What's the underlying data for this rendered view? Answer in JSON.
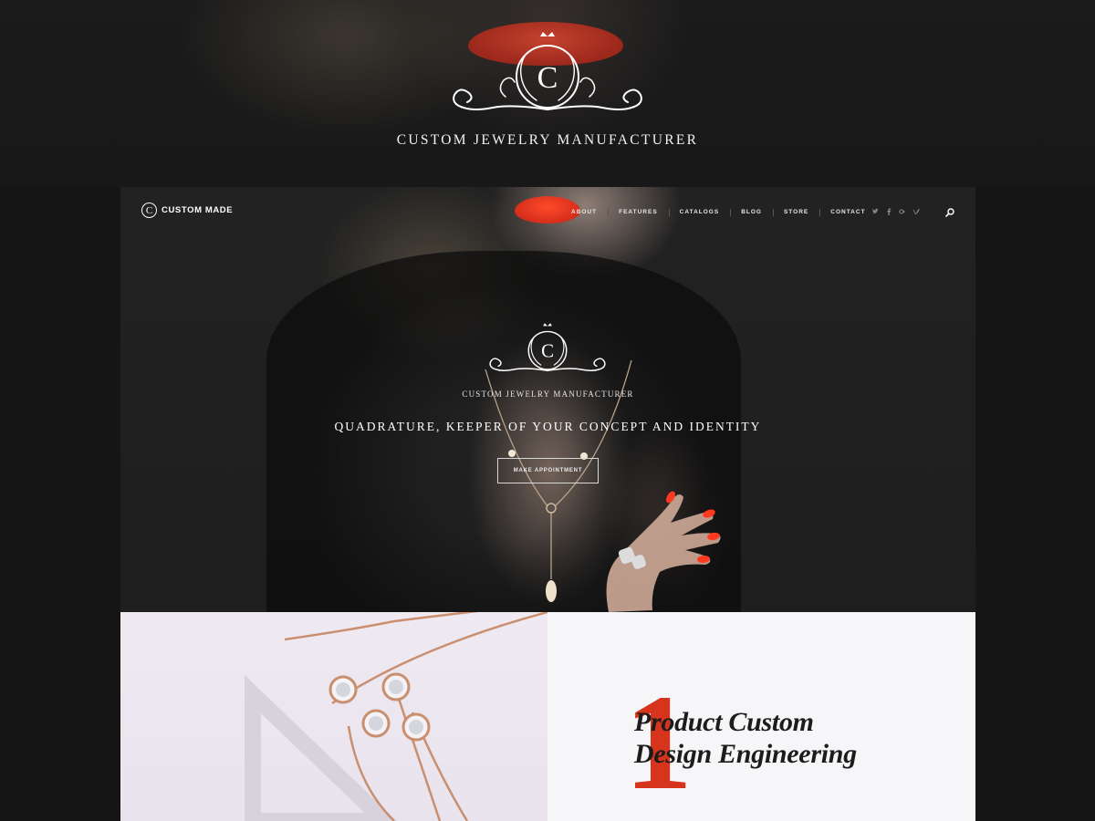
{
  "banner": {
    "emblem_letter": "C",
    "title": "CUSTOM JEWELRY MANUFACTURER"
  },
  "nav": {
    "logo_letter": "C",
    "logo_text": "CUSTOM MADE",
    "items": [
      "ABOUT",
      "FEATURES",
      "CATALOGS",
      "BLOG",
      "STORE",
      "CONTACT"
    ],
    "social_icons": [
      "twitter-icon",
      "facebook-icon",
      "google-plus-icon",
      "vimeo-icon"
    ],
    "social_glyphs": [
      "ᴀ",
      "f",
      "g+",
      "v"
    ],
    "search_icon": "search-icon"
  },
  "hero": {
    "emblem_letter": "C",
    "small_title": "CUSTOM JEWELRY MANUFACTURER",
    "headline": "QUADRATURE, KEEPER OF YOUR CONCEPT AND IDENTITY",
    "button_label": "MAKE APPOINTMENT"
  },
  "feature": {
    "number": "1",
    "heading_line1": "Product Custom",
    "heading_line2": "Design Engineering"
  },
  "colors": {
    "accent": "#d6341c",
    "background": "#151515",
    "section_light": "#f6f6f9"
  }
}
